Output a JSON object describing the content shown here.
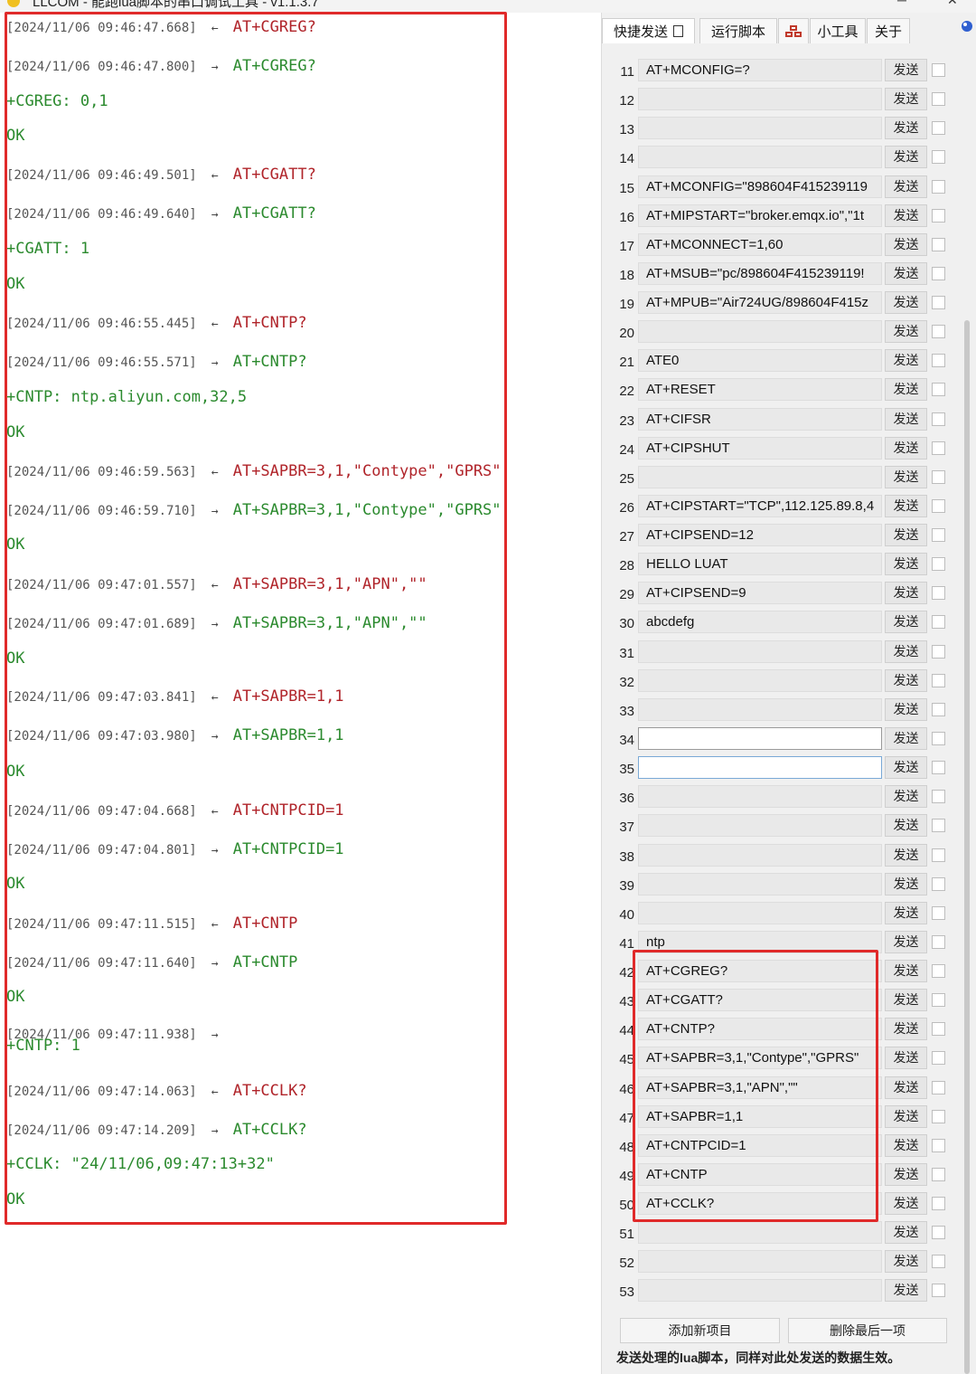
{
  "titlebar": {
    "title": "LLCOM - 能跑lua脚本的串口调试工具 - v1.1.3.7",
    "minimize": "─",
    "close": "✕"
  },
  "log": [
    {
      "ts": "[2024/11/06 09:46:47.668]",
      "dir": "←",
      "cmd": "AT+CGREG?",
      "kind": "tx"
    },
    {
      "ts": "[2024/11/06 09:46:47.800]",
      "dir": "→",
      "cmd": "AT+CGREG?",
      "kind": "rx"
    },
    {
      "text": "+CGREG: 0,1"
    },
    {
      "text": "OK"
    },
    {
      "ts": "[2024/11/06 09:46:49.501]",
      "dir": "←",
      "cmd": "AT+CGATT?",
      "kind": "tx"
    },
    {
      "ts": "[2024/11/06 09:46:49.640]",
      "dir": "→",
      "cmd": "AT+CGATT?",
      "kind": "rx"
    },
    {
      "text": "+CGATT: 1"
    },
    {
      "text": "OK"
    },
    {
      "ts": "[2024/11/06 09:46:55.445]",
      "dir": "←",
      "cmd": "AT+CNTP?",
      "kind": "tx"
    },
    {
      "ts": "[2024/11/06 09:46:55.571]",
      "dir": "→",
      "cmd": "AT+CNTP?",
      "kind": "rx"
    },
    {
      "text": "+CNTP: ntp.aliyun.com,32,5"
    },
    {
      "text": "OK"
    },
    {
      "ts": "[2024/11/06 09:46:59.563]",
      "dir": "←",
      "cmd": "AT+SAPBR=3,1,\"Contype\",\"GPRS\"",
      "kind": "tx"
    },
    {
      "ts": "[2024/11/06 09:46:59.710]",
      "dir": "→",
      "cmd": "AT+SAPBR=3,1,\"Contype\",\"GPRS\"",
      "kind": "rx"
    },
    {
      "text": "OK"
    },
    {
      "ts": "[2024/11/06 09:47:01.557]",
      "dir": "←",
      "cmd": "AT+SAPBR=3,1,\"APN\",\"\"",
      "kind": "tx"
    },
    {
      "ts": "[2024/11/06 09:47:01.689]",
      "dir": "→",
      "cmd": "AT+SAPBR=3,1,\"APN\",\"\"",
      "kind": "rx"
    },
    {
      "text": "OK"
    },
    {
      "ts": "[2024/11/06 09:47:03.841]",
      "dir": "←",
      "cmd": "AT+SAPBR=1,1",
      "kind": "tx"
    },
    {
      "ts": "[2024/11/06 09:47:03.980]",
      "dir": "→",
      "cmd": "AT+SAPBR=1,1",
      "kind": "rx"
    },
    {
      "text": "OK"
    },
    {
      "ts": "[2024/11/06 09:47:04.668]",
      "dir": "←",
      "cmd": "AT+CNTPCID=1",
      "kind": "tx"
    },
    {
      "ts": "[2024/11/06 09:47:04.801]",
      "dir": "→",
      "cmd": "AT+CNTPCID=1",
      "kind": "rx"
    },
    {
      "text": "OK"
    },
    {
      "ts": "[2024/11/06 09:47:11.515]",
      "dir": "←",
      "cmd": "AT+CNTP",
      "kind": "tx"
    },
    {
      "ts": "[2024/11/06 09:47:11.640]",
      "dir": "→",
      "cmd": "AT+CNTP",
      "kind": "rx"
    },
    {
      "text": "OK"
    },
    {
      "ts": "[2024/11/06 09:47:11.938]",
      "dir": "→",
      "cmd": "",
      "kind": "rx"
    },
    {
      "text": "+CNTP: 1"
    },
    {
      "ts": "[2024/11/06 09:47:14.063]",
      "dir": "←",
      "cmd": "AT+CCLK?",
      "kind": "tx"
    },
    {
      "ts": "[2024/11/06 09:47:14.209]",
      "dir": "→",
      "cmd": "AT+CCLK?",
      "kind": "rx"
    },
    {
      "text": "+CCLK: \"24/11/06,09:47:13+32\""
    },
    {
      "text": "OK"
    }
  ],
  "tabs": [
    {
      "label": "快捷发送"
    },
    {
      "label": "运行脚本"
    },
    {
      "label": ""
    },
    {
      "label": "小工具"
    },
    {
      "label": "关于"
    }
  ],
  "send_label": "发送",
  "quick_send": [
    {
      "num": "11",
      "cmd": "AT+MCONFIG=?"
    },
    {
      "num": "12",
      "cmd": ""
    },
    {
      "num": "13",
      "cmd": ""
    },
    {
      "num": "14",
      "cmd": ""
    },
    {
      "num": "15",
      "cmd": "AT+MCONFIG=\"898604F415239119"
    },
    {
      "num": "16",
      "cmd": "AT+MIPSTART=\"broker.emqx.io\",\"1t"
    },
    {
      "num": "17",
      "cmd": "AT+MCONNECT=1,60"
    },
    {
      "num": "18",
      "cmd": "AT+MSUB=\"pc/898604F415239119!"
    },
    {
      "num": "19",
      "cmd": "AT+MPUB=\"Air724UG/898604F415z"
    },
    {
      "num": "20",
      "cmd": ""
    },
    {
      "num": "21",
      "cmd": "ATE0"
    },
    {
      "num": "22",
      "cmd": "AT+RESET"
    },
    {
      "num": "23",
      "cmd": "AT+CIFSR"
    },
    {
      "num": "24",
      "cmd": "AT+CIPSHUT"
    },
    {
      "num": "25",
      "cmd": ""
    },
    {
      "num": "26",
      "cmd": "AT+CIPSTART=\"TCP\",112.125.89.8,4"
    },
    {
      "num": "27",
      "cmd": "AT+CIPSEND=12"
    },
    {
      "num": "28",
      "cmd": "HELLO LUAT"
    },
    {
      "num": "29",
      "cmd": "AT+CIPSEND=9"
    },
    {
      "num": "30",
      "cmd": "abcdefg"
    },
    {
      "num": "31",
      "cmd": ""
    },
    {
      "num": "32",
      "cmd": ""
    },
    {
      "num": "33",
      "cmd": ""
    },
    {
      "num": "34",
      "cmd": ""
    },
    {
      "num": "35",
      "cmd": ""
    },
    {
      "num": "36",
      "cmd": ""
    },
    {
      "num": "37",
      "cmd": ""
    },
    {
      "num": "38",
      "cmd": ""
    },
    {
      "num": "39",
      "cmd": ""
    },
    {
      "num": "40",
      "cmd": ""
    },
    {
      "num": "41",
      "cmd": "ntp"
    },
    {
      "num": "42",
      "cmd": "AT+CGREG?"
    },
    {
      "num": "43",
      "cmd": "AT+CGATT?"
    },
    {
      "num": "44",
      "cmd": " AT+CNTP?"
    },
    {
      "num": "45",
      "cmd": "AT+SAPBR=3,1,\"Contype\",\"GPRS\""
    },
    {
      "num": "46",
      "cmd": "AT+SAPBR=3,1,\"APN\",\"\""
    },
    {
      "num": "47",
      "cmd": "AT+SAPBR=1,1"
    },
    {
      "num": "48",
      "cmd": "AT+CNTPCID=1"
    },
    {
      "num": "49",
      "cmd": "AT+CNTP"
    },
    {
      "num": "50",
      "cmd": "AT+CCLK?"
    },
    {
      "num": "51",
      "cmd": ""
    },
    {
      "num": "52",
      "cmd": ""
    },
    {
      "num": "53",
      "cmd": ""
    }
  ],
  "buttons": {
    "add": "添加新项目",
    "delete": "删除最后一项"
  },
  "bottom_note": "发送处理的lua脚本，同样对此处发送的数据生效。",
  "colors": {
    "highlight": "#e02a2a",
    "tx": "#b0242a",
    "rx": "#2b8a2e"
  }
}
